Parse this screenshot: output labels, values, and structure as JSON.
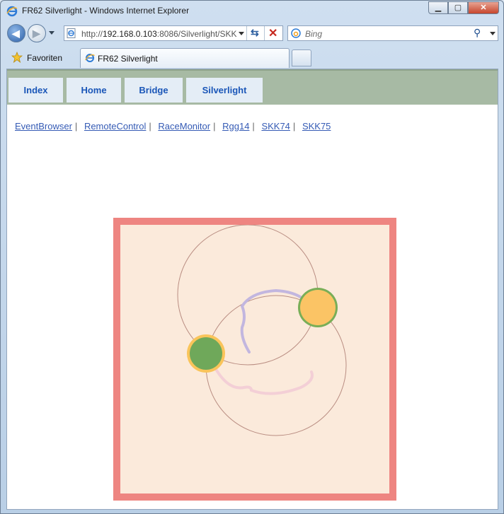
{
  "window": {
    "title": "FR62 Silverlight - Windows Internet Explorer",
    "controls": {
      "minimize": "▁",
      "maximize": "▢",
      "close": "✕"
    }
  },
  "address_bar": {
    "url_prefix": "http://",
    "url_host": "192.168.0.103",
    "url_rest": ":8086/Silverlight/SKK"
  },
  "search_bar": {
    "placeholder": "Bing"
  },
  "favorites": {
    "label": "Favoriten"
  },
  "tab": {
    "label": "FR62 Silverlight"
  },
  "page": {
    "menu": [
      {
        "label": "Index"
      },
      {
        "label": "Home"
      },
      {
        "label": "Bridge"
      },
      {
        "label": "Silverlight"
      }
    ],
    "links": [
      {
        "label": "EventBrowser"
      },
      {
        "label": "RemoteControl"
      },
      {
        "label": "RaceMonitor"
      },
      {
        "label": "Rgg14"
      },
      {
        "label": "SKK74"
      },
      {
        "label": "SKK75"
      }
    ],
    "link_separator": "|"
  },
  "colors": {
    "frame": "#ee8581",
    "canvas": "#fbeadb",
    "menu_bar": "#a7baa4",
    "menu_button": "#e4edf6",
    "link": "#355bb5"
  },
  "icons": {
    "back": "arrow-left",
    "forward": "arrow-right",
    "refresh": "refresh",
    "stop": "x-mark",
    "search": "magnifier",
    "favorites": "star",
    "page": "ie-logo"
  }
}
